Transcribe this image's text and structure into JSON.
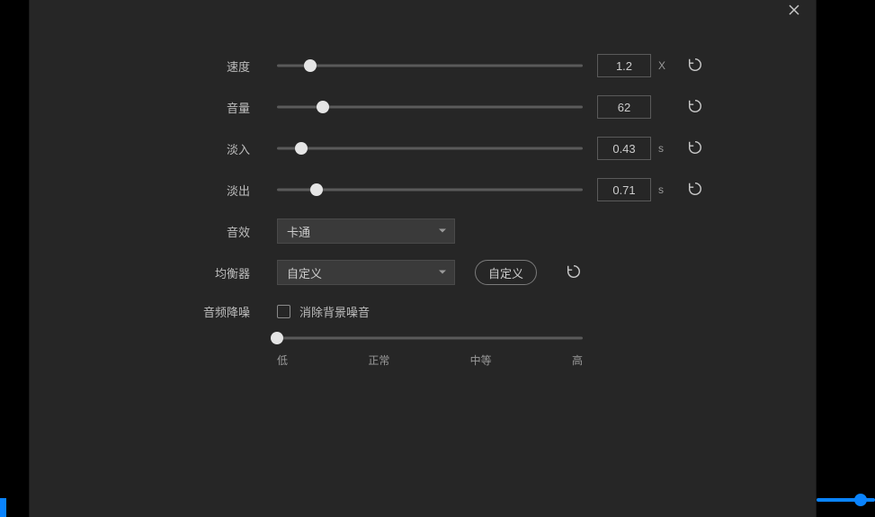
{
  "speed": {
    "label": "速度",
    "value": "1.2",
    "unit": "X",
    "percent": 11
  },
  "volume": {
    "label": "音量",
    "value": "62",
    "unit": "",
    "percent": 15
  },
  "fadeIn": {
    "label": "淡入",
    "value": "0.43",
    "unit": "s",
    "percent": 8
  },
  "fadeOut": {
    "label": "淡出",
    "value": "0.71",
    "unit": "s",
    "percent": 13
  },
  "effect": {
    "label": "音效",
    "selected": "卡通"
  },
  "equalizer": {
    "label": "均衡器",
    "selected": "自定义",
    "customBtn": "自定义"
  },
  "denoise": {
    "label": "音频降噪",
    "checkboxLabel": "消除背景噪音",
    "percent": 0,
    "ticks": [
      "低",
      "正常",
      "中等",
      "高"
    ]
  }
}
